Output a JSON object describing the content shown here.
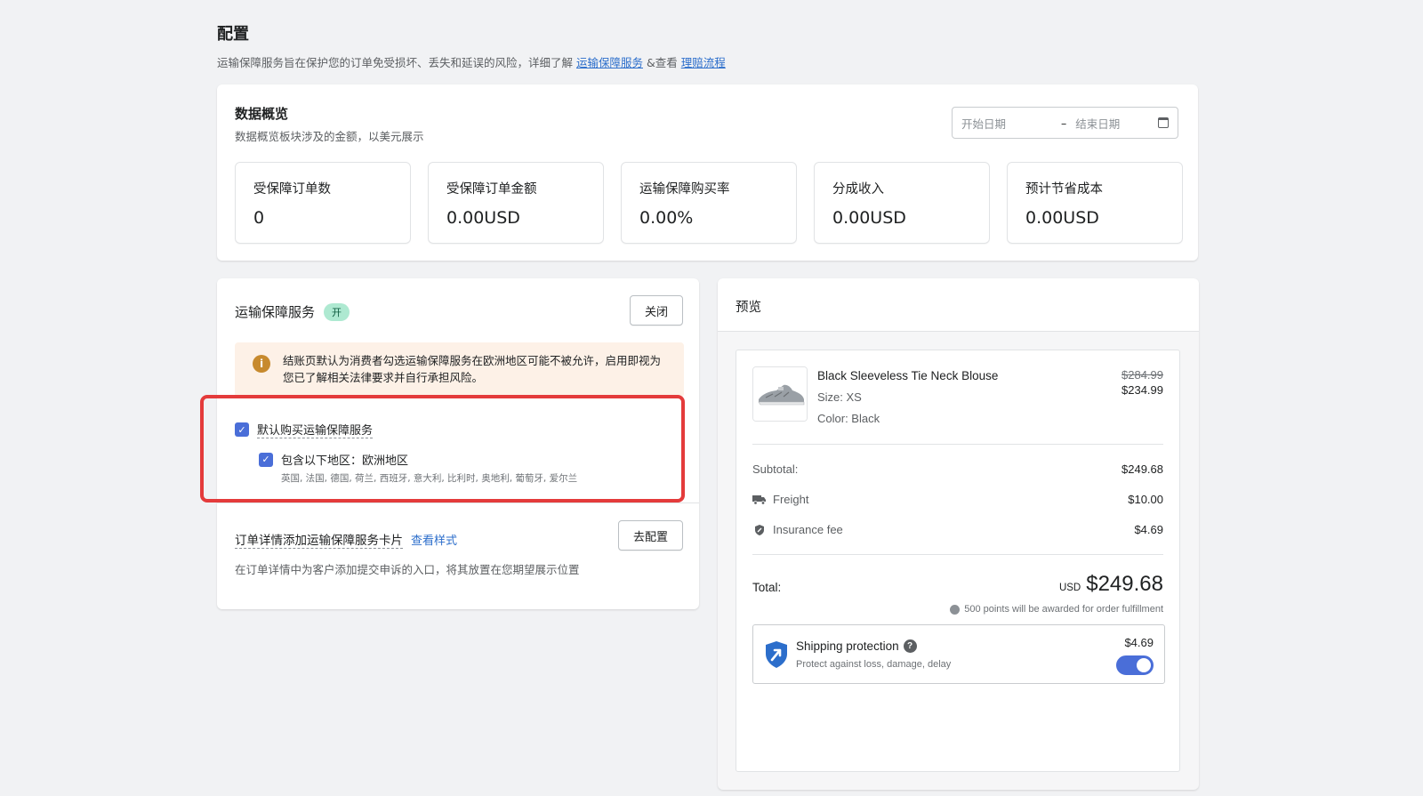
{
  "header": {
    "title": "配置",
    "desc_prefix": "运输保障服务旨在保护您的订单免受损坏、丢失和延误的风险，详细了解 ",
    "link1": "运输保障服务",
    "desc_middle": " &查看 ",
    "link2": "理赔流程"
  },
  "overview": {
    "title": "数据概览",
    "subtitle": "数据概览板块涉及的金额，以美元展示",
    "date_start_placeholder": "开始日期",
    "date_end_placeholder": "结束日期",
    "stats": [
      {
        "label": "受保障订单数",
        "value": "0"
      },
      {
        "label": "受保障订单金额",
        "value": "0.00USD"
      },
      {
        "label": "运输保障购买率",
        "value": "0.00%"
      },
      {
        "label": "分成收入",
        "value": "0.00USD"
      },
      {
        "label": "预计节省成本",
        "value": "0.00USD"
      }
    ]
  },
  "service": {
    "title": "运输保障服务",
    "status_badge": "开",
    "close_button": "关闭",
    "warning": "结账页默认为消费者勾选运输保障服务在欧洲地区可能不被允许，启用即视为您已了解相关法律要求并自行承担风险。",
    "default_purchase_label": "默认购买运输保障服务",
    "include_regions_label": "包含以下地区：欧洲地区",
    "countries": "英国, 法国, 德国, 荷兰, 西班牙, 意大利, 比利时, 奥地利, 葡萄牙, 爱尔兰",
    "order_card_label": "订单详情添加运输保障服务卡片",
    "view_style_link": "查看样式",
    "config_button": "去配置",
    "order_card_desc": "在订单详情中为客户添加提交申诉的入口，将其放置在您期望展示位置"
  },
  "preview": {
    "title": "预览",
    "product": {
      "name": "Black Sleeveless Tie Neck Blouse",
      "size": "Size: XS",
      "color": "Color: Black",
      "original_price": "$284.99",
      "price": "$234.99"
    },
    "subtotal_label": "Subtotal:",
    "subtotal_value": "$249.68",
    "freight_label": "Freight",
    "freight_value": "$10.00",
    "insurance_label": "Insurance fee",
    "insurance_value": "$4.69",
    "total_label": "Total:",
    "total_currency": "USD",
    "total_value": "$249.68",
    "points_text": "500 points will be awarded for order fulfillment",
    "protection": {
      "title": "Shipping protection",
      "subtitle": "Protect against loss, damage, delay",
      "price": "$4.69",
      "enabled": true
    }
  },
  "colors": {
    "accent": "#4a6ed8",
    "link": "#2c6ecb",
    "highlight_border": "#e43b3b",
    "warning_bg": "#fdf1e7",
    "badge_bg": "#aee9d1"
  }
}
